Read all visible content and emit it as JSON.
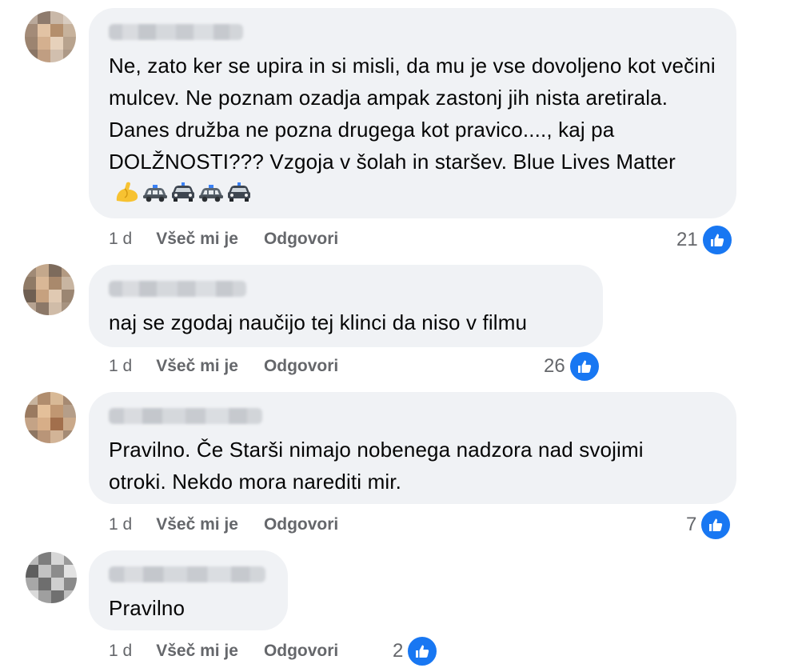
{
  "comments": [
    {
      "text": "Ne, zato ker se upira in si misli, da mu je vse dovoljeno kot večini mulcev. Ne poznam ozadja ampak zastonj jih nista aretirala. Danes družba ne pozna drugega kot pravico...., kaj pa DOLŽNOSTI??? Vzgoja v šolah in staršev. Blue Lives Matter",
      "emoji_names": [
        "flexed-biceps-icon",
        "police-car-icon",
        "oncoming-police-car-icon",
        "police-car-icon",
        "oncoming-police-car-icon"
      ],
      "time": "1 d",
      "like_label": "Všeč mi je",
      "reply_label": "Odgovori",
      "reaction_count": "21"
    },
    {
      "text": "naj se zgodaj naučijo tej klinci da niso v filmu",
      "time": "1 d",
      "like_label": "Všeč mi je",
      "reply_label": "Odgovori",
      "reaction_count": "26"
    },
    {
      "text": "Pravilno. Če Starši nimajo nobenega nadzora nad svojimi otroki. Nekdo mora narediti mir.",
      "time": "1 d",
      "like_label": "Všeč mi je",
      "reply_label": "Odgovori",
      "reaction_count": "7"
    },
    {
      "text": "Pravilno",
      "time": "1 d",
      "like_label": "Všeč mi je",
      "reply_label": "Odgovori",
      "reaction_count": "2"
    }
  ],
  "colors": {
    "bubble_bg": "#f0f2f5",
    "meta_text": "#65676b",
    "like_blue": "#1877f2",
    "text": "#050505"
  }
}
